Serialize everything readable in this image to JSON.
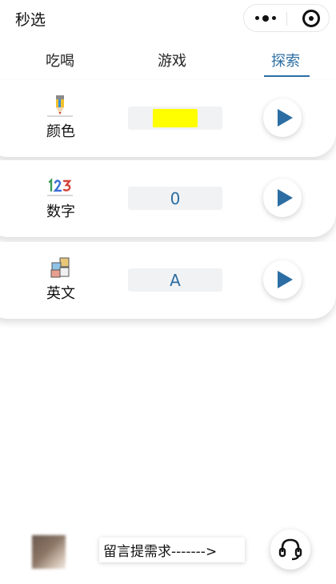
{
  "header": {
    "title": "秒选"
  },
  "capsule": {
    "menu_icon": "more-dots-icon",
    "close_icon": "target-circle-icon"
  },
  "tabs": [
    {
      "label": "吃喝",
      "active": false
    },
    {
      "label": "游戏",
      "active": false
    },
    {
      "label": "探索",
      "active": true
    }
  ],
  "accent_color": "#2c6ea3",
  "cards": [
    {
      "label": "颜色",
      "icon": "pencil-icon",
      "value": "",
      "swatch_color": "#ffff00"
    },
    {
      "label": "数字",
      "icon": "numbers-123-icon",
      "value": "0"
    },
    {
      "label": "英文",
      "icon": "abc-blocks-icon",
      "value": "A"
    }
  ],
  "footer": {
    "feedback_label": "留言提需求------->",
    "support_icon": "headset-icon"
  }
}
